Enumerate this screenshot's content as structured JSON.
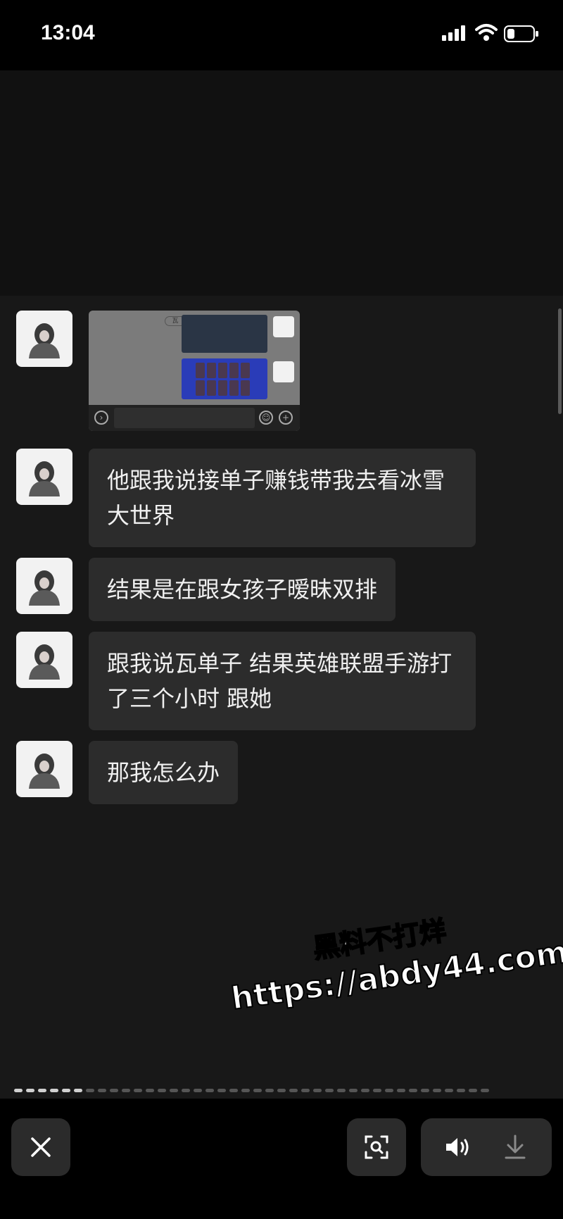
{
  "status_bar": {
    "time": "13:04"
  },
  "messages": [
    {
      "type": "image",
      "description_badge": "瓦"
    },
    {
      "type": "text",
      "text": "他跟我说接单子赚钱带我去看冰雪大世界"
    },
    {
      "type": "text",
      "text": "结果是在跟女孩子暧昧双排"
    },
    {
      "type": "text",
      "text": "跟我说瓦单子 结果英雄联盟手游打了三个小时 跟她"
    },
    {
      "type": "text",
      "text": "那我怎么办"
    }
  ],
  "watermark": {
    "line1": "黑料不打烊",
    "line2": "https://abdy44.com"
  },
  "icons": {
    "close": "close-icon",
    "scan": "scan-icon",
    "volume": "volume-icon",
    "download": "download-icon"
  },
  "page_indicator": {
    "total": 40,
    "active": [
      0,
      1,
      2,
      3,
      4,
      5
    ]
  }
}
